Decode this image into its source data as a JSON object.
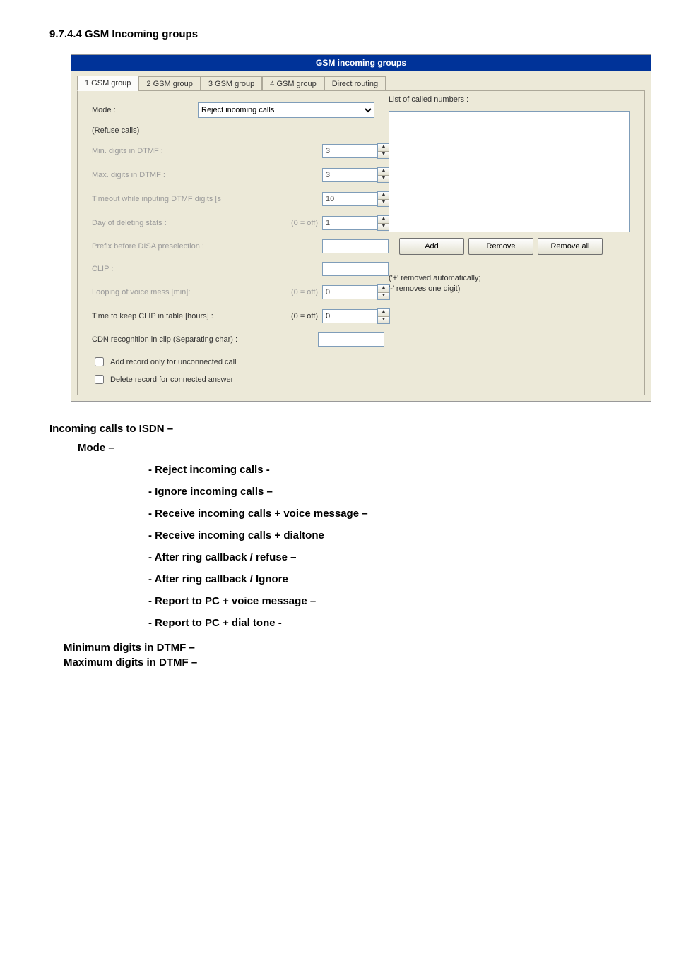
{
  "heading": "9.7.4.4  GSM Incoming groups",
  "dialog": {
    "title": "GSM incoming groups",
    "tabs": [
      "1 GSM group",
      "2 GSM group",
      "3 GSM group",
      "4 GSM group",
      "Direct routing"
    ],
    "fields": {
      "mode_label": "Mode :",
      "mode_value": "Reject incoming calls",
      "refuse": "(Refuse calls)",
      "min_digits": "Min. digits in DTMF :",
      "min_digits_val": "3",
      "max_digits": "Max. digits in DTMF :",
      "max_digits_val": "3",
      "timeout": "Timeout while inputing DTMF digits [s",
      "timeout_val": "10",
      "day_delete": "Day of deleting stats :",
      "day_delete_off": "(0 = off)",
      "day_delete_val": "1",
      "prefix": "Prefix before DISA preselection :",
      "prefix_val": "",
      "clip": "CLIP :",
      "clip_val": "",
      "looping": "Looping of voice mess [min]:",
      "looping_off": "(0 = off)",
      "looping_val": "0",
      "keep_clip": "Time to keep CLIP in table [hours] :",
      "keep_clip_off": "(0 = off)",
      "keep_clip_val": "0",
      "cdn": "CDN recognition in clip (Separating char) :",
      "cdn_val": "",
      "add_record": "Add record only for unconnected call",
      "delete_record": "Delete record for connected answer"
    },
    "list_label": "List of called numbers :",
    "buttons": {
      "add": "Add",
      "remove": "Remove",
      "remove_all": "Remove all"
    },
    "hint1": "('+' removed automatically;",
    "hint2": "'-' removes one digit)"
  },
  "below": {
    "incoming": "Incoming calls to ISDN –",
    "mode": "Mode –",
    "items": [
      "- Reject incoming calls -",
      "- Ignore incoming calls –",
      "- Receive incoming calls + voice message –",
      "- Receive incoming calls + dialtone",
      "- After ring callback / refuse –",
      "- After ring callback / Ignore",
      "- Report to PC + voice message –",
      "- Report to PC + dial tone -"
    ],
    "min": "Minimum digits in DTMF –",
    "max": "Maximum  digits  in  DTMF  –"
  }
}
